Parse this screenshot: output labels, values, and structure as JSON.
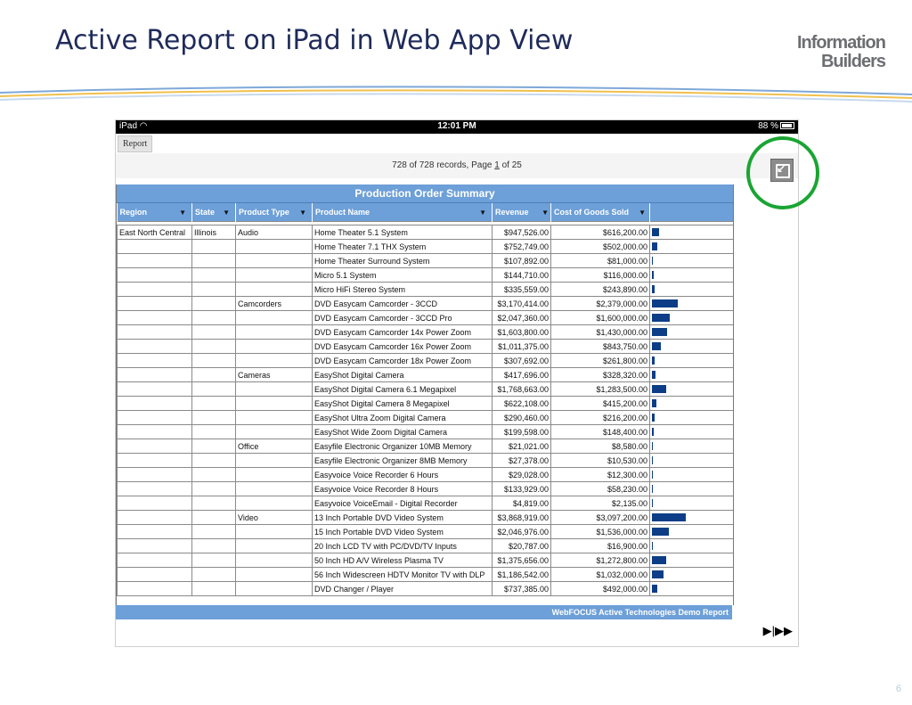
{
  "slide": {
    "title": "Active Report on iPad in Web App View",
    "logo_line1": "Information",
    "logo_line2": "Builders",
    "number": "6"
  },
  "statusbar": {
    "device": "iPad",
    "time": "12:01 PM",
    "battery": "88 %"
  },
  "tab": {
    "label": "Report"
  },
  "nav": {
    "prefix": "728 of 728 records, Page",
    "page": "1",
    "suffix": "of 25"
  },
  "table": {
    "caption": "Production Order Summary",
    "columns": [
      "Region",
      "State",
      "Product Type",
      "Product Name",
      "Revenue",
      "Cost of Goods Sold"
    ],
    "footer": "WebFOCUS Active Technologies Demo Report",
    "rows": [
      {
        "region": "East North Central",
        "state": "Illinois",
        "type": "Audio",
        "name": "Home Theater 5.1 System",
        "revenue": "$947,526.00",
        "cost": "$616,200.00",
        "bar": 0.2
      },
      {
        "region": "",
        "state": "",
        "type": "",
        "name": "Home Theater 7.1 THX System",
        "revenue": "$752,749.00",
        "cost": "$502,000.00",
        "bar": 0.16
      },
      {
        "region": "",
        "state": "",
        "type": "",
        "name": "Home Theater Surround System",
        "revenue": "$107,892.00",
        "cost": "$81,000.00",
        "bar": 0.03
      },
      {
        "region": "",
        "state": "",
        "type": "",
        "name": "Micro 5.1 System",
        "revenue": "$144,710.00",
        "cost": "$116,000.00",
        "bar": 0.04
      },
      {
        "region": "",
        "state": "",
        "type": "",
        "name": "Micro HiFi Stereo System",
        "revenue": "$335,559.00",
        "cost": "$243,890.00",
        "bar": 0.08
      },
      {
        "region": "",
        "state": "",
        "type": "Camcorders",
        "name": "DVD Easycam Camcorder - 3CCD",
        "revenue": "$3,170,414.00",
        "cost": "$2,379,000.00",
        "bar": 0.77
      },
      {
        "region": "",
        "state": "",
        "type": "",
        "name": "DVD Easycam Camcorder - 3CCD Pro",
        "revenue": "$2,047,360.00",
        "cost": "$1,600,000.00",
        "bar": 0.52
      },
      {
        "region": "",
        "state": "",
        "type": "",
        "name": "DVD Easycam Camcorder 14x Power Zoom",
        "revenue": "$1,603,800.00",
        "cost": "$1,430,000.00",
        "bar": 0.46
      },
      {
        "region": "",
        "state": "",
        "type": "",
        "name": "DVD Easycam Camcorder 16x Power Zoom",
        "revenue": "$1,011,375.00",
        "cost": "$843,750.00",
        "bar": 0.27
      },
      {
        "region": "",
        "state": "",
        "type": "",
        "name": "DVD Easycam Camcorder 18x Power Zoom",
        "revenue": "$307,692.00",
        "cost": "$261,800.00",
        "bar": 0.08
      },
      {
        "region": "",
        "state": "",
        "type": "Cameras",
        "name": "EasyShot Digital Camera",
        "revenue": "$417,696.00",
        "cost": "$328,320.00",
        "bar": 0.11
      },
      {
        "region": "",
        "state": "",
        "type": "",
        "name": "EasyShot Digital Camera 6.1 Megapixel",
        "revenue": "$1,768,663.00",
        "cost": "$1,283,500.00",
        "bar": 0.41
      },
      {
        "region": "",
        "state": "",
        "type": "",
        "name": "EasyShot Digital Camera 8 Megapixel",
        "revenue": "$622,108.00",
        "cost": "$415,200.00",
        "bar": 0.13
      },
      {
        "region": "",
        "state": "",
        "type": "",
        "name": "EasyShot Ultra Zoom Digital Camera",
        "revenue": "$290,460.00",
        "cost": "$216,200.00",
        "bar": 0.07
      },
      {
        "region": "",
        "state": "",
        "type": "",
        "name": "EasyShot Wide Zoom Digital Camera",
        "revenue": "$199,598.00",
        "cost": "$148,400.00",
        "bar": 0.05
      },
      {
        "region": "",
        "state": "",
        "type": "Office",
        "name": "Easyfile Electronic Organizer 10MB Memory",
        "revenue": "$21,021.00",
        "cost": "$8,580.00",
        "bar": 0.003
      },
      {
        "region": "",
        "state": "",
        "type": "",
        "name": "Easyfile Electronic Organizer 8MB Memory",
        "revenue": "$27,378.00",
        "cost": "$10,530.00",
        "bar": 0.004
      },
      {
        "region": "",
        "state": "",
        "type": "",
        "name": "Easyvoice Voice Recorder 6 Hours",
        "revenue": "$29,028.00",
        "cost": "$12,300.00",
        "bar": 0.004
      },
      {
        "region": "",
        "state": "",
        "type": "",
        "name": "Easyvoice Voice Recorder 8 Hours",
        "revenue": "$133,929.00",
        "cost": "$58,230.00",
        "bar": 0.02
      },
      {
        "region": "",
        "state": "",
        "type": "",
        "name": "Easyvoice VoiceEmail - Digital Recorder",
        "revenue": "$4,819.00",
        "cost": "$2,135.00",
        "bar": 0.001
      },
      {
        "region": "",
        "state": "",
        "type": "Video",
        "name": "13 Inch Portable DVD Video System",
        "revenue": "$3,868,919.00",
        "cost": "$3,097,200.00",
        "bar": 1.0
      },
      {
        "region": "",
        "state": "",
        "type": "",
        "name": "15 Inch Portable DVD Video System",
        "revenue": "$2,046,976.00",
        "cost": "$1,536,000.00",
        "bar": 0.5
      },
      {
        "region": "",
        "state": "",
        "type": "",
        "name": "20 Inch LCD TV with PC/DVD/TV Inputs",
        "revenue": "$20,787.00",
        "cost": "$16,900.00",
        "bar": 0.005
      },
      {
        "region": "",
        "state": "",
        "type": "",
        "name": "50 Inch HD A/V Wireless Plasma TV",
        "revenue": "$1,375,656.00",
        "cost": "$1,272,800.00",
        "bar": 0.41
      },
      {
        "region": "",
        "state": "",
        "type": "",
        "name": "56 Inch Widescreen HDTV Monitor TV with DLP",
        "revenue": "$1,186,542.00",
        "cost": "$1,032,000.00",
        "bar": 0.33
      },
      {
        "region": "",
        "state": "",
        "type": "",
        "name": "DVD Changer / Player",
        "revenue": "$737,385.00",
        "cost": "$492,000.00",
        "bar": 0.16
      }
    ]
  },
  "colors": {
    "header_blue": "#6d9fd8",
    "bar_blue": "#0d3d87",
    "highlight_green": "#1aa533",
    "title_navy": "#1f2b5b"
  },
  "icons": {
    "restore": "restore-view-icon",
    "sort": "sort-down-icon",
    "pager": "next-last-page-icon"
  }
}
